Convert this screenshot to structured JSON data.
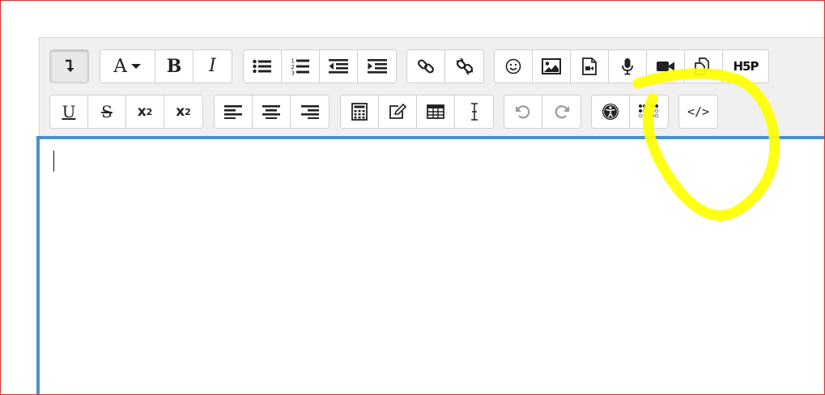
{
  "editor": {
    "content_text": ""
  },
  "toolbar": {
    "row1": [
      {
        "name": "toolbar-toggle-button",
        "icon": "arrow-down-turn-icon",
        "state": "pressed"
      },
      {
        "name": "font-style-button",
        "label": "A",
        "icon": "caret-down-icon"
      },
      {
        "name": "bold-button",
        "label": "B"
      },
      {
        "name": "italic-button",
        "label": "I"
      },
      {
        "name": "unordered-list-button",
        "icon": "bullet-list-icon"
      },
      {
        "name": "ordered-list-button",
        "icon": "numbered-list-icon"
      },
      {
        "name": "outdent-button",
        "icon": "outdent-icon"
      },
      {
        "name": "indent-button",
        "icon": "indent-icon"
      },
      {
        "name": "link-button",
        "icon": "link-icon"
      },
      {
        "name": "unlink-button",
        "icon": "unlink-icon"
      },
      {
        "name": "emoticon-button",
        "icon": "smiley-icon"
      },
      {
        "name": "image-button",
        "icon": "image-icon"
      },
      {
        "name": "media-button",
        "icon": "media-file-icon"
      },
      {
        "name": "record-audio-button",
        "icon": "microphone-icon"
      },
      {
        "name": "record-video-button",
        "icon": "video-camera-icon"
      },
      {
        "name": "manage-files-button",
        "icon": "files-icon"
      },
      {
        "name": "h5p-button",
        "label": "H5P"
      }
    ],
    "row2": [
      {
        "name": "underline-button",
        "label": "U"
      },
      {
        "name": "strikethrough-button",
        "label": "S"
      },
      {
        "name": "subscript-button",
        "label": "x",
        "sub": "2"
      },
      {
        "name": "superscript-button",
        "label": "x",
        "sup": "2"
      },
      {
        "name": "align-left-button",
        "icon": "align-left-icon"
      },
      {
        "name": "align-center-button",
        "icon": "align-center-icon"
      },
      {
        "name": "align-right-button",
        "icon": "align-right-icon"
      },
      {
        "name": "equation-button",
        "icon": "calculator-icon"
      },
      {
        "name": "special-character-button",
        "icon": "pencil-square-icon"
      },
      {
        "name": "table-button",
        "icon": "table-icon"
      },
      {
        "name": "clear-formatting-button",
        "icon": "text-cursor-icon"
      },
      {
        "name": "undo-button",
        "icon": "undo-icon",
        "state": "disabled"
      },
      {
        "name": "redo-button",
        "icon": "redo-icon",
        "state": "disabled"
      },
      {
        "name": "accessibility-checker-button",
        "icon": "accessibility-icon"
      },
      {
        "name": "screenreader-helper-button",
        "icon": "braille-icon"
      },
      {
        "name": "html-source-button",
        "icon": "code-icon"
      }
    ]
  },
  "labels": {
    "font_a": "A",
    "bold": "B",
    "italic": "I",
    "underline": "U",
    "strike": "S",
    "sub_x": "x",
    "sub_2": "2",
    "sup_x": "x",
    "sup_2": "2",
    "h5p": "H5P",
    "list_nums": [
      "1",
      "2",
      "3"
    ],
    "code": "</>"
  },
  "colors": {
    "focus_border": "#4a90d2",
    "annotation_highlight": "#ffff00",
    "toolbar_bg": "#f0f0f0",
    "frame_border": "#d9302b"
  }
}
